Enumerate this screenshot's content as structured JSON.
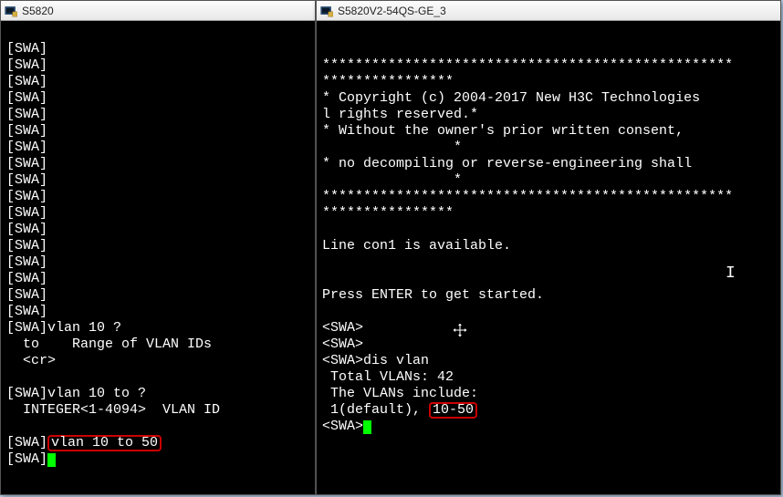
{
  "window_left": {
    "title": "S5820",
    "lines": [
      "[SWA]",
      "[SWA]",
      "[SWA]",
      "[SWA]",
      "[SWA]",
      "[SWA]",
      "[SWA]",
      "[SWA]",
      "[SWA]",
      "[SWA]",
      "[SWA]",
      "[SWA]",
      "[SWA]",
      "[SWA]",
      "[SWA]",
      "[SWA]",
      "[SWA]",
      "[SWA]vlan 10 ?",
      "  to    Range of VLAN IDs",
      "  <cr>",
      "",
      "[SWA]vlan 10 to ?",
      "  INTEGER<1-4094>  VLAN ID",
      ""
    ],
    "highlight_prefix": "[SWA]",
    "highlight_text": "vlan 10 to 50",
    "final_line": "[SWA]"
  },
  "window_right": {
    "title": "S5820V2-54QS-GE_3",
    "lines_top": [
      "",
      "**************************************************",
      "****************",
      "* Copyright (c) 2004-2017 New H3C Technologies",
      "l rights reserved.*",
      "* Without the owner's prior written consent, ",
      "                *",
      "* no decompiling or reverse-engineering shall",
      "                *",
      "**************************************************",
      "****************",
      "",
      "Line con1 is available.",
      "",
      "",
      "Press ENTER to get started.",
      "",
      "<SWA>",
      "<SWA>",
      "<SWA>dis vlan",
      " Total VLANs: 42",
      " The VLANs include:"
    ],
    "vlan_row_prefix": " 1(default), ",
    "vlan_highlight": "10-50",
    "final_line": "<SWA>"
  }
}
